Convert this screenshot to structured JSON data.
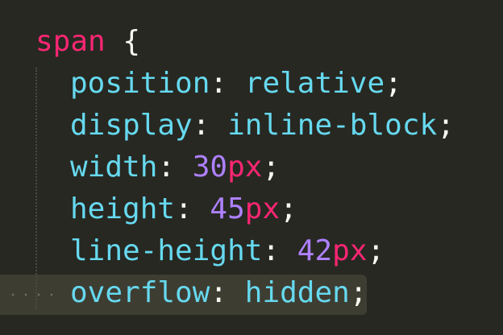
{
  "code": {
    "selector": "span",
    "open_brace": "{",
    "declarations": [
      {
        "property": "position",
        "colon": ":",
        "value": "relative",
        "semicolon": ";"
      },
      {
        "property": "display",
        "colon": ":",
        "value": "inline-block",
        "semicolon": ";"
      },
      {
        "property": "width",
        "colon": ":",
        "number": "30",
        "unit": "px",
        "semicolon": ";"
      },
      {
        "property": "height",
        "colon": ":",
        "number": "45",
        "unit": "px",
        "semicolon": ";"
      },
      {
        "property": "line-height",
        "colon": ":",
        "number": "42",
        "unit": "px",
        "semicolon": ";"
      },
      {
        "property": "overflow",
        "colon": ":",
        "value": "hidden",
        "semicolon": ";"
      }
    ],
    "highlighted_line": 6
  },
  "theme": {
    "background": "#272822",
    "selector_color": "#f92672",
    "property_color": "#66d9ef",
    "number_color": "#ae81ff",
    "unit_color": "#f92672",
    "text_color": "#f8f8f2",
    "line_highlight": "#3e3d32"
  }
}
